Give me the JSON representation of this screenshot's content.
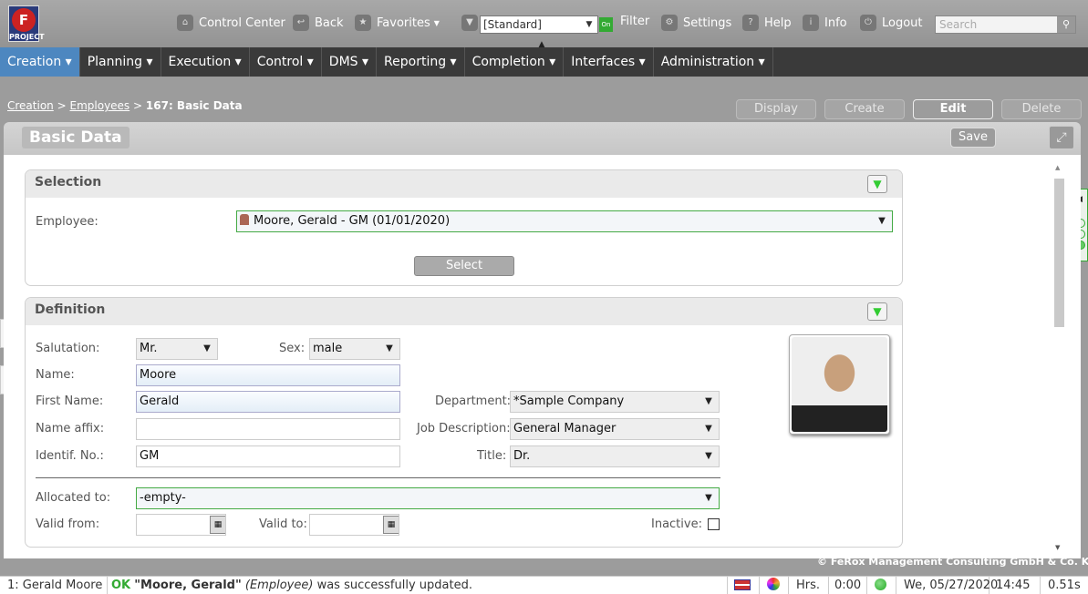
{
  "toolbar": {
    "logo_text": "PROJECT",
    "control_center": "Control Center",
    "back": "Back",
    "favorites": "Favorites",
    "filter_value": "[Standard]",
    "filter_on": "On",
    "filter": "Filter",
    "settings": "Settings",
    "help": "Help",
    "info": "Info",
    "logout": "Logout",
    "search_placeholder": "Search"
  },
  "menu": [
    {
      "label": "Creation ▾"
    },
    {
      "label": "Planning ▾"
    },
    {
      "label": "Execution ▾"
    },
    {
      "label": "Control ▾"
    },
    {
      "label": "DMS ▾"
    },
    {
      "label": "Reporting ▾"
    },
    {
      "label": "Completion ▾"
    },
    {
      "label": "Interfaces ▾"
    },
    {
      "label": "Administration ▾"
    }
  ],
  "breadcrumb": {
    "creation": "Creation",
    "sep1": ">",
    "employees": "Employees",
    "sep2": ">",
    "current": "167: Basic Data"
  },
  "actions": {
    "display": "Display",
    "create": "Create",
    "edit": "Edit",
    "delete": "Delete"
  },
  "panel": {
    "title": "Basic Data",
    "save": "Save"
  },
  "selection": {
    "title": "Selection",
    "employee_label": "Employee:",
    "employee_value": "Moore, Gerald - GM (01/01/2020)",
    "select_button": "Select"
  },
  "definition": {
    "title": "Definition",
    "salutation_label": "Salutation:",
    "salutation_value": "Mr.",
    "sex_label": "Sex:",
    "sex_value": "male",
    "name_label": "Name:",
    "name_value": "Moore",
    "first_name_label": "First Name:",
    "first_name_value": "Gerald",
    "name_affix_label": "Name affix:",
    "name_affix_value": "",
    "identif_label": "Identif. No.:",
    "identif_value": "GM",
    "department_label": "Department:",
    "department_value": "*Sample Company",
    "job_label": "Job Description:",
    "job_value": "General Manager",
    "title_label": "Title:",
    "title_value": "Dr.",
    "allocated_label": "Allocated to:",
    "allocated_value": "-empty-",
    "valid_from_label": "Valid from:",
    "valid_from_value": "",
    "valid_to_label": "Valid to:",
    "valid_to_value": "",
    "inactive_label": "Inactive:"
  },
  "copyright": "© FeRox Management Consulting GmbH & Co. KG",
  "status": {
    "user": "1: Gerald Moore",
    "ok": "OK",
    "msg_name": "\"Moore, Gerald\"",
    "msg_type": "(Employee)",
    "msg_rest": "was successfully updated.",
    "hrs_label": "Hrs.",
    "hrs_value": "0:00",
    "date": "We, 05/27/2020",
    "time": "14:45",
    "duration": "0.51s"
  },
  "colors": {
    "menu_active": "#4d87c0",
    "ok_green": "#33aa33",
    "accent_green": "#44aa44"
  }
}
